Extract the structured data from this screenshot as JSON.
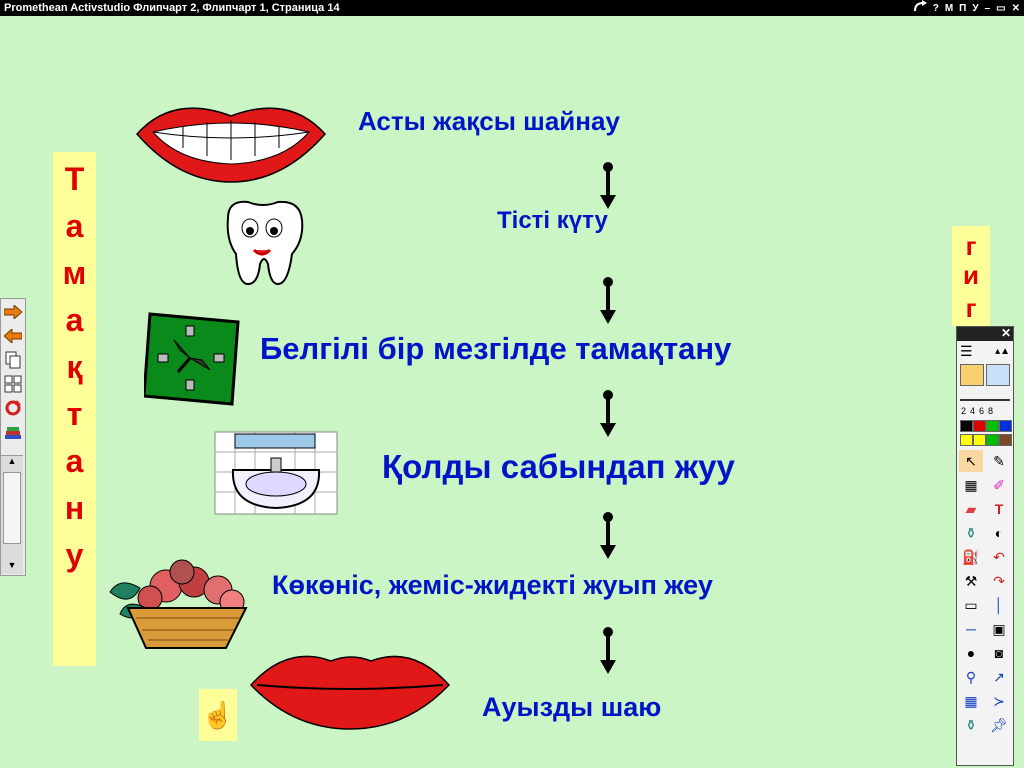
{
  "titlebar": {
    "title": "Promethean Activstudio   Флипчарт 2,  Флипчарт 1,  Страница 14",
    "controls": [
      "?",
      "М",
      "П",
      "У",
      "–",
      "▭",
      "✕"
    ]
  },
  "left_banner": {
    "letters": [
      "Т",
      "а",
      "м",
      "а",
      "қ",
      "т",
      "а",
      "н",
      "у"
    ]
  },
  "right_banner": {
    "letters": [
      "г",
      "и",
      "г"
    ]
  },
  "steps": [
    "Асты жақсы шайнау",
    "Тісті күту",
    "Белгілі бір мезгілде тамақтану",
    "Қолды сабындап жуу",
    "Көкөніс, жеміс-жидекті жуып жеу",
    "Ауызды шаю"
  ],
  "toolbox": {
    "pen_widths": [
      "2",
      "4",
      "6",
      "8"
    ],
    "colors": [
      "#000000",
      "#e00000",
      "#00c000",
      "#0030e0",
      "#ffff00",
      "#ffff00",
      "#00c000",
      "#7a4a2a"
    ]
  },
  "colors": {
    "background": "#ccf5c6",
    "text": "#0014c8",
    "banner": "#ffff99",
    "banner_text": "#e00000"
  }
}
